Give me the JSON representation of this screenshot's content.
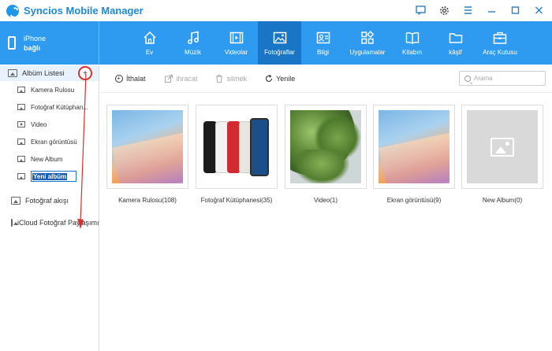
{
  "app": {
    "title": "Syncios Mobile Manager"
  },
  "device": {
    "name": "iPhone",
    "status": "bağlı"
  },
  "nav": [
    {
      "label": "Ev",
      "icon": "home-icon"
    },
    {
      "label": "Müzik",
      "icon": "music-icon"
    },
    {
      "label": "Videolar",
      "icon": "video-icon"
    },
    {
      "label": "Fotoğraflar",
      "icon": "photo-icon",
      "active": true
    },
    {
      "label": "Bilgi",
      "icon": "contacts-icon"
    },
    {
      "label": "Uygulamalar",
      "icon": "apps-icon"
    },
    {
      "label": "Kitabın",
      "icon": "book-icon"
    },
    {
      "label": "kâşif",
      "icon": "folder-icon"
    },
    {
      "label": "Araç Kutusu",
      "icon": "toolbox-icon"
    }
  ],
  "sidebar": {
    "header": "Albüm Listesi",
    "albums": [
      {
        "label": "Kamera Rulosu",
        "icon": "photo-icon"
      },
      {
        "label": "Fotoğraf Kütüphan...",
        "icon": "photo-icon"
      },
      {
        "label": "Video",
        "icon": "video-icon"
      },
      {
        "label": "Ekran görüntüsü",
        "icon": "photo-icon"
      },
      {
        "label": "New Album",
        "icon": "photo-icon"
      }
    ],
    "new_album_value": "Yeni albüm",
    "sections": [
      {
        "label": "Fotoğraf akışı",
        "icon": "photo-stream-icon"
      },
      {
        "label": "iCloud Fotoğraf Paylaşımı",
        "icon": "icloud-icon"
      }
    ]
  },
  "toolbar": {
    "import": "İthalat",
    "export": "ihracat",
    "delete": "silmek",
    "refresh": "Yenile",
    "search_placeholder": "Arama"
  },
  "grid": [
    {
      "label": "Kamera Rulosu(108)",
      "thumb": "ipad"
    },
    {
      "label": "Fotoğraf Kütüphanesi(35)",
      "thumb": "iphones"
    },
    {
      "label": "Video(1)",
      "thumb": "leaves"
    },
    {
      "label": "Ekran görüntüsü(9)",
      "thumb": "ipad"
    },
    {
      "label": "New Album(0)",
      "thumb": "empty"
    }
  ],
  "colors": {
    "brand": "#2e9bf0",
    "nav_active": "#1976c6",
    "title": "#1d89d8",
    "highlight": "#d8302f"
  }
}
